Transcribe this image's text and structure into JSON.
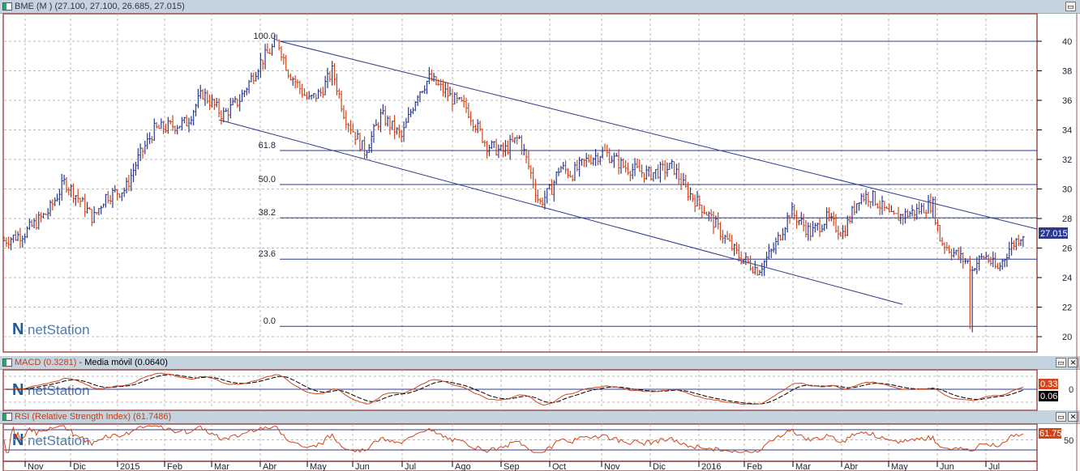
{
  "main": {
    "title": "BME (M ) (27.100, 27.100, 26.685, 27.015)",
    "last_price": "27.015",
    "y_ticks": [
      "40",
      "38",
      "36",
      "34",
      "32",
      "30",
      "28",
      "26",
      "24",
      "22",
      "20"
    ],
    "fib_labels": [
      "100.0",
      "61.8",
      "50.0",
      "38.2",
      "23.6",
      "0.0"
    ]
  },
  "macd": {
    "title": "MACD (0.3281)",
    "title2": "Media móvil (0.0640)",
    "value": "0.33",
    "signal": "0.06",
    "zero": "0"
  },
  "rsi": {
    "title": "RSI (Relative Strength Index) (61.7486)",
    "value": "61.75",
    "tick": "50"
  },
  "logo": "netStation",
  "months": [
    "Nov",
    "Dic",
    "2015",
    "Feb",
    "Mar",
    "Abr",
    "May",
    "Jun",
    "Jul",
    "Ago",
    "Sep",
    "Oct",
    "Nov",
    "Dic",
    "2016",
    "Feb",
    "Mar",
    "Abr",
    "May",
    "Jun",
    "Jul"
  ],
  "colors": {
    "up": "#2b3a8c",
    "down": "#d0451b",
    "line": "#2b3a8c",
    "frame": "#a05050"
  },
  "chart_data": {
    "type": "ohlc",
    "ylim": [
      20,
      40
    ],
    "fib_levels": [
      {
        "label": "100.0",
        "price": 40
      },
      {
        "label": "61.8",
        "price": 32.6
      },
      {
        "label": "50.0",
        "price": 30.3
      },
      {
        "label": "38.2",
        "price": 28.05
      },
      {
        "label": "23.6",
        "price": 25.25
      },
      {
        "label": "0.0",
        "price": 20.7
      }
    ],
    "anchors_months_since_nov2014": [
      [
        -0.44,
        26.5
      ],
      [
        -0.02,
        27
      ],
      [
        0.49,
        28.5
      ],
      [
        0.82,
        30.5
      ],
      [
        1.07,
        29.5
      ],
      [
        1.41,
        28
      ],
      [
        1.66,
        29.5
      ],
      [
        2.08,
        30
      ],
      [
        2.33,
        32
      ],
      [
        2.67,
        34
      ],
      [
        3.34,
        34.5
      ],
      [
        3.67,
        36.5
      ],
      [
        4.09,
        35
      ],
      [
        4.43,
        36
      ],
      [
        4.85,
        38.5
      ],
      [
        5.23,
        40
      ],
      [
        5.44,
        38
      ],
      [
        5.86,
        36
      ],
      [
        6.11,
        36.5
      ],
      [
        6.36,
        38
      ],
      [
        6.61,
        35
      ],
      [
        7.03,
        32.5
      ],
      [
        7.37,
        35
      ],
      [
        7.79,
        33.5
      ],
      [
        8.12,
        36.5
      ],
      [
        8.37,
        37.5
      ],
      [
        8.88,
        36
      ],
      [
        9.13,
        35.5
      ],
      [
        9.55,
        33
      ],
      [
        9.88,
        32.5
      ],
      [
        10.22,
        33.5
      ],
      [
        10.47,
        31
      ],
      [
        10.64,
        29
      ],
      [
        10.89,
        30
      ],
      [
        11.06,
        31.5
      ],
      [
        11.31,
        31
      ],
      [
        11.64,
        32
      ],
      [
        11.98,
        32.5
      ],
      [
        12.4,
        31.5
      ],
      [
        12.9,
        31
      ],
      [
        13.41,
        31.5
      ],
      [
        13.66,
        30
      ],
      [
        14.08,
        28.5
      ],
      [
        14.41,
        27
      ],
      [
        14.75,
        25.5
      ],
      [
        15.17,
        24.5
      ],
      [
        15.5,
        26
      ],
      [
        15.84,
        28.5
      ],
      [
        16.26,
        27
      ],
      [
        16.59,
        28
      ],
      [
        16.93,
        27
      ],
      [
        17.26,
        29.5
      ],
      [
        17.52,
        29.5
      ],
      [
        17.94,
        28
      ],
      [
        18.44,
        28.5
      ],
      [
        18.78,
        29
      ],
      [
        18.94,
        26.5
      ],
      [
        19.28,
        25.5
      ],
      [
        19.61,
        24.8
      ],
      [
        19.87,
        25.5
      ],
      [
        20.12,
        24.5
      ],
      [
        20.37,
        26
      ],
      [
        20.65,
        27
      ]
    ]
  }
}
